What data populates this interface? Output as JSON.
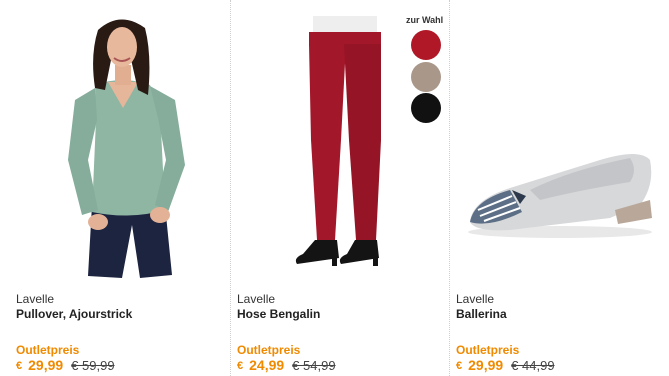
{
  "products": [
    {
      "brand": "Lavelle",
      "name": "Pullover, Ajourstrick",
      "price_label": "Outletpreis",
      "currency": "€",
      "price": "29,99",
      "old_price": "€ 59,99",
      "image": "woman in mint green v-neck pullover and dark jeans"
    },
    {
      "brand": "Lavelle",
      "name": "Hose Bengalin",
      "price_label": "Outletpreis",
      "currency": "€",
      "price": "24,99",
      "old_price": "€ 54,99",
      "image": "red slim trousers with black pumps",
      "color_choice_label": "zur Wahl",
      "swatches": [
        "#b01828",
        "#a9978a",
        "#111111"
      ]
    },
    {
      "brand": "Lavelle",
      "name": "Ballerina",
      "price_label": "Outletpreis",
      "currency": "€",
      "price": "29,99",
      "old_price": "€ 44,99",
      "image": "light grey ballerina shoe with striped toe cap"
    }
  ],
  "colors": {
    "accent": "#f08a00",
    "text": "#222222",
    "divider": "#cfcfcf"
  }
}
